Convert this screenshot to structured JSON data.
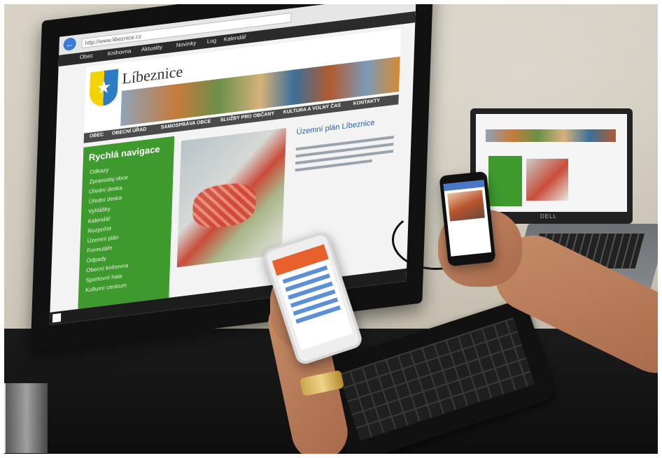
{
  "monitor": {
    "browser_url": "http://www.libeznice.cz",
    "favorites": [
      "Obec",
      "Knihovna",
      "Aktuality",
      "Novinky",
      "Log",
      "Kalendář"
    ],
    "site_title": "Líbeznice",
    "nav": [
      "OBEC",
      "OBECNÍ ÚŘAD",
      "SAMOSPRÁVA OBCE",
      "SLUŽBY PRO OBČANY",
      "KULTURA A VOLNÝ ČAS",
      "KONTAKTY"
    ],
    "quick_nav_title": "Rychlá navigace",
    "quick_links": [
      "Odkazy",
      "Zpravodaj obce",
      "Úřední deska",
      "Úřední deska",
      "Vyhlášky",
      "Kalendář",
      "Rozpočet",
      "Územní plán",
      "Formuláře",
      "Odpady",
      "Obecní knihovna",
      "Sportovní hala",
      "Kulturní centrum"
    ],
    "news_title": "Územní plán Líbeznice"
  },
  "laptop": {
    "brand": "DELL"
  },
  "colors": {
    "site_green": "#3f9a2e",
    "nav_dark": "#4a4a4a",
    "phone_accent": "#e8602c",
    "link_blue": "#2a5d9f"
  }
}
